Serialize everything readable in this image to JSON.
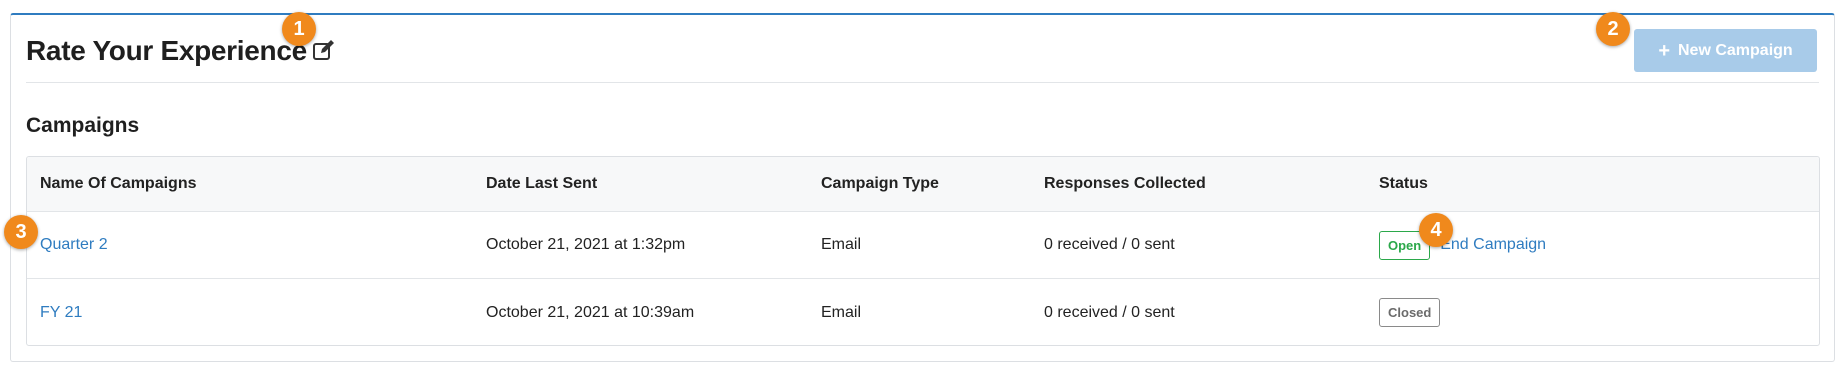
{
  "header": {
    "title": "Rate Your Experience",
    "edit_icon": "pencil-square-icon",
    "new_campaign_label": "New Campaign",
    "new_campaign_icon": "plus-icon"
  },
  "section": {
    "heading": "Campaigns"
  },
  "table": {
    "columns": [
      "Name Of Campaigns",
      "Date Last Sent",
      "Campaign Type",
      "Responses Collected",
      "Status"
    ],
    "rows": [
      {
        "name": "Quarter 2",
        "date": "October 21, 2021 at 1:32pm",
        "type": "Email",
        "responses": "0 received / 0 sent",
        "status": "Open",
        "action": "End Campaign"
      },
      {
        "name": "FY 21",
        "date": "October 21, 2021 at 10:39am",
        "type": "Email",
        "responses": "0 received / 0 sent",
        "status": "Closed"
      }
    ]
  },
  "callouts": [
    "1",
    "2",
    "3",
    "4"
  ],
  "colors": {
    "accent": "#2f7cc0",
    "button_disabled": "#a8cbe9",
    "open_badge": "#2ba84a",
    "callout": "#f0891c"
  }
}
